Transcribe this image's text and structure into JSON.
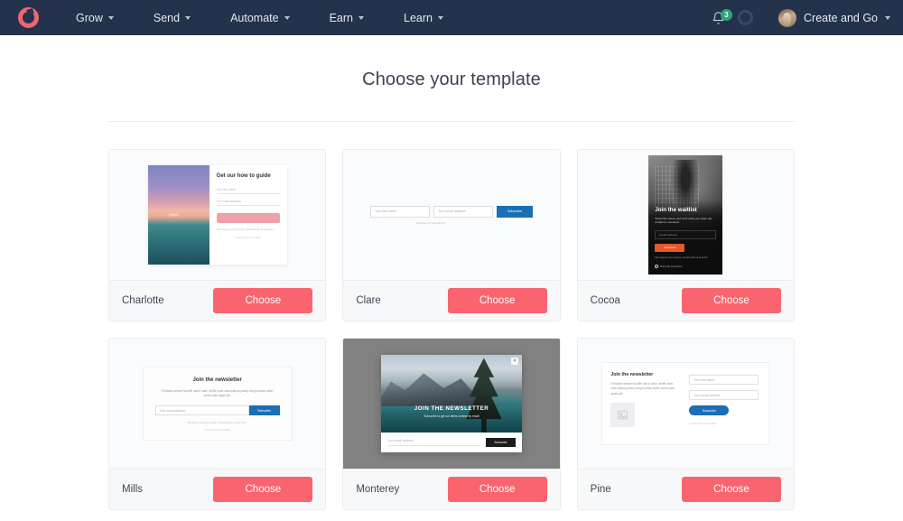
{
  "navbar": {
    "logo_name": "convertkit-logo",
    "brand_color": "#ef6572",
    "links": [
      {
        "label": "Grow"
      },
      {
        "label": "Send"
      },
      {
        "label": "Automate"
      },
      {
        "label": "Earn"
      },
      {
        "label": "Learn"
      }
    ],
    "notifications": {
      "count": "3",
      "badge_color": "#2ea37a"
    },
    "account": {
      "name": "Create and Go"
    }
  },
  "page": {
    "title": "Choose your template"
  },
  "common": {
    "choose_label": "Choose",
    "powered_by": "Powered by ConvertKit",
    "first_name_placeholder": "Your first name",
    "email_placeholder": "Your email address",
    "subscribe_label": "Subscribe",
    "accent_color": "#f9646f"
  },
  "templates": [
    {
      "name": "Charlotte",
      "choose_label": "Choose",
      "preview": {
        "heading": "Get our how to guide",
        "first_name": "Your first name",
        "email": "Your email address",
        "cta": "Send me the guide",
        "note": "We respect your privacy. Unsubscribe at anytime.",
        "powered_by": "Powered by ConvertKit"
      }
    },
    {
      "name": "Clare",
      "choose_label": "Choose",
      "preview": {
        "first_name": "Your first name",
        "email": "Your email address",
        "cta": "Subscribe",
        "powered_by": "Powered by ConvertKit"
      }
    },
    {
      "name": "Cocoa",
      "choose_label": "Choose",
      "preview": {
        "heading": "Join the waitlist",
        "subheading": "Subscribe below and we'll notify you when the product is released.",
        "email": "Email address",
        "cta": "Subscribe",
        "note": "We respect your privacy. Unsubscribe at anytime.",
        "powered_by": "Built with ConvertKit"
      }
    },
    {
      "name": "Mills",
      "choose_label": "Choose",
      "preview": {
        "heading": "Join the newsletter",
        "body": "Fruitcake dessert soufflé carrot cake. Muffin bear claw lollipop pastry icing bonbon wafer carrot cake apple pie.",
        "email": "Your email address",
        "cta": "Subscribe",
        "note": "We won't send you spam. Unsubscribe at any time.",
        "powered_by": "Powered by ConvertKit"
      }
    },
    {
      "name": "Monterey",
      "choose_label": "Choose",
      "preview": {
        "heading": "JOIN THE NEWSLETTER",
        "subheading": "Subscribe to get our latest content by email",
        "email": "Your email address",
        "cta": "Subscribe",
        "close": "×"
      }
    },
    {
      "name": "Pine",
      "choose_label": "Choose",
      "preview": {
        "heading": "Join the newsletter",
        "body": "Fruitcake dessert soufflé carrot cake. Muffin bear claw lollipop pastry icing bonbon wafer carrot cake apple pie.",
        "first_name": "Your first name",
        "email": "Your email address",
        "cta": "Subscribe",
        "powered_by": "Powered by ConvertKit"
      }
    }
  ]
}
